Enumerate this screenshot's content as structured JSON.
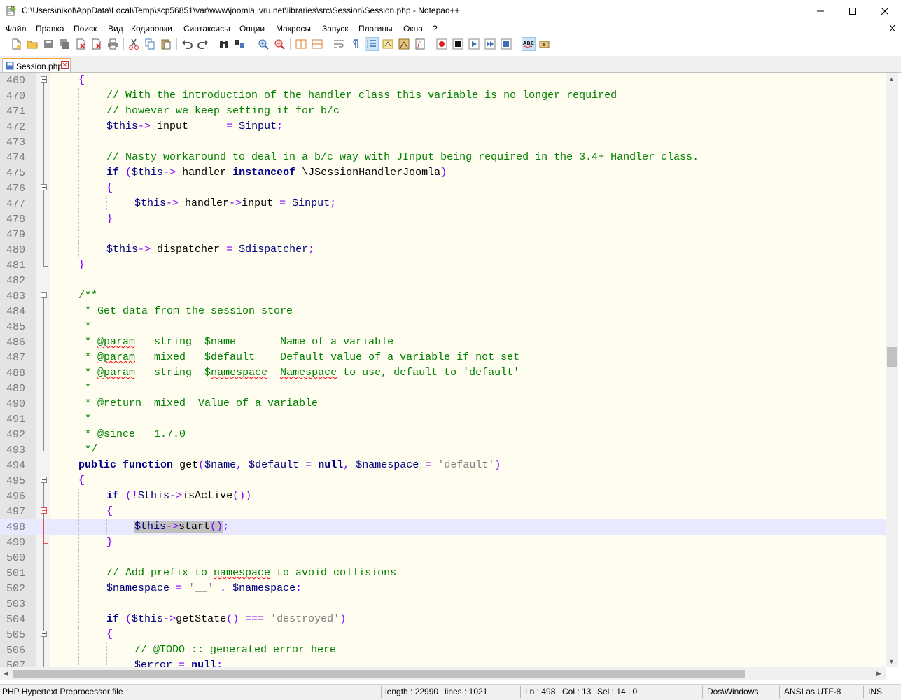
{
  "window": {
    "title": "C:\\Users\\nikol\\AppData\\Local\\Temp\\scp56851\\var\\www\\joomla.ivru.net\\libraries\\src\\Session\\Session.php - Notepad++"
  },
  "menu": [
    "Файл",
    "Правка",
    "Поиск",
    "Вид",
    "Кодировки",
    "Синтаксисы",
    "Опции",
    "Макросы",
    "Запуск",
    "Плагины",
    "Окна",
    "?"
  ],
  "menu_close": "X",
  "tab": {
    "label": "Session.php"
  },
  "line_numbers": [
    "469",
    "470",
    "471",
    "472",
    "473",
    "474",
    "475",
    "476",
    "477",
    "478",
    "479",
    "480",
    "481",
    "482",
    "483",
    "484",
    "485",
    "486",
    "487",
    "488",
    "489",
    "490",
    "491",
    "492",
    "493",
    "494",
    "495",
    "496",
    "497",
    "498",
    "499",
    "500",
    "501",
    "502",
    "503",
    "504",
    "505",
    "506",
    "507"
  ],
  "code": {
    "l469_brace": "{",
    "l470": "// With the introduction of the handler class this variable is no longer required",
    "l471": "// however we keep setting it for b/c",
    "l472_var1": "$this",
    "l472_arrow": "->",
    "l472_prop": "_input",
    "l472_eq": "=",
    "l472_var2": "$input",
    "l472_semi": ";",
    "l474": "// Nasty workaround to deal in a b/c way with JInput being required in the 3.4+ Handler class.",
    "l475_if": "if",
    "l475_p1": "(",
    "l475_var": "$this",
    "l475_arrow": "->",
    "l475_prop": "_handler",
    "l475_kw": "instanceof",
    "l475_cls": "\\JSessionHandlerJoomla",
    "l475_p2": ")",
    "l476_brace": "{",
    "l477_var": "$this",
    "l477_arrow1": "->",
    "l477_prop1": "_handler",
    "l477_arrow2": "->",
    "l477_prop2": "input",
    "l477_eq": "=",
    "l477_var2": "$input",
    "l477_semi": ";",
    "l478_brace": "}",
    "l480_var": "$this",
    "l480_arrow": "->",
    "l480_prop": "_dispatcher",
    "l480_eq": "=",
    "l480_var2": "$dispatcher",
    "l480_semi": ";",
    "l481_brace": "}",
    "l483": "/**",
    "l484": " * Get data from the session store",
    "l485": " *",
    "l486_a": " * ",
    "l486_tag": "@param",
    "l486_b": "   string  $name       Name of a variable",
    "l487_a": " * ",
    "l487_tag": "@param",
    "l487_b": "   mixed   $default    Default value of a variable if not set",
    "l488_a": " * ",
    "l488_tag": "@param",
    "l488_b": "   string  $",
    "l488_ns1": "namespace",
    "l488_c": "  ",
    "l488_ns2": "Namespace",
    "l488_d": " to use, default to 'default'",
    "l489": " *",
    "l490": " * @return  mixed  Value of a variable",
    "l491": " *",
    "l492": " * @since   1.7.0",
    "l493": " */",
    "l494_public": "public",
    "l494_function": "function",
    "l494_name": "get",
    "l494_p1": "(",
    "l494_v1": "$name",
    "l494_c1": ",",
    "l494_v2": "$default",
    "l494_eq": "=",
    "l494_null": "null",
    "l494_c2": ",",
    "l494_v3": "$namespace",
    "l494_eq2": "=",
    "l494_str": "'default'",
    "l494_p2": ")",
    "l495_brace": "{",
    "l496_if": "if",
    "l496_p1": "(!",
    "l496_var": "$this",
    "l496_arrow": "->",
    "l496_method": "isActive",
    "l496_p2": "())",
    "l497_brace": "{",
    "l498_var": "$this",
    "l498_arrow": "->",
    "l498_method": "start",
    "l498_parens": "()",
    "l498_semi": ";",
    "l499_brace": "}",
    "l501_a": "// Add prefix to ",
    "l501_ns": "namespace",
    "l501_b": " to avoid collisions",
    "l502_var": "$namespace",
    "l502_eq": "=",
    "l502_str": "'__'",
    "l502_dot": ".",
    "l502_var2": "$namespace",
    "l502_semi": ";",
    "l504_if": "if",
    "l504_p1": "(",
    "l504_var": "$this",
    "l504_arrow": "->",
    "l504_method": "getState",
    "l504_p2": "()",
    "l504_eq": "===",
    "l504_str": "'destroyed'",
    "l504_p3": ")",
    "l505_brace": "{",
    "l506": "// @TODO :: generated error here",
    "l507_var": "$error",
    "l507_eq": "=",
    "l507_null": "null",
    "l507_semi": ";"
  },
  "status": {
    "filetype": "PHP Hypertext Preprocessor file",
    "length": "length : 22990",
    "lines": "lines : 1021",
    "ln": "Ln : 498",
    "col": "Col : 13",
    "sel": "Sel : 14 | 0",
    "eol": "Dos\\Windows",
    "encoding": "ANSI as UTF-8",
    "mode": "INS"
  },
  "colors": {
    "comment": "#008000",
    "keyword": "#00008b",
    "variable": "#000080",
    "operator": "#8000ff",
    "string": "#808080",
    "current_line": "#e8e8ff",
    "editor_bg": "#fffdf0",
    "tab_accent": "#f9a33b"
  },
  "icons": {
    "app": "notepadpp-icon",
    "minimize": "minimize-icon",
    "maximize": "maximize-icon",
    "close": "close-icon"
  }
}
